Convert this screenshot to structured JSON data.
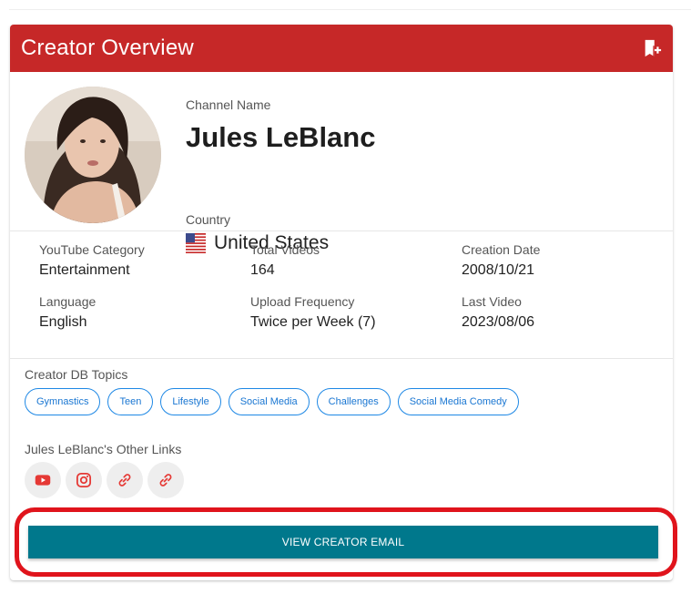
{
  "header": {
    "title": "Creator Overview",
    "bookmark_icon": "bookmark-add-icon"
  },
  "profile": {
    "channel_name_label": "Channel Name",
    "channel_name": "Jules LeBlanc",
    "country_label": "Country",
    "country": "United States",
    "flag_icon": "us-flag-icon"
  },
  "stats": [
    {
      "label": "YouTube Category",
      "value": "Entertainment"
    },
    {
      "label": "Total Videos",
      "value": "164"
    },
    {
      "label": "Creation Date",
      "value": "2008/10/21"
    },
    {
      "label": "Language",
      "value": "English"
    },
    {
      "label": "Upload Frequency",
      "value": "Twice per Week (7)"
    },
    {
      "label": "Last Video",
      "value": "2023/08/06"
    }
  ],
  "topics": {
    "label": "Creator DB Topics",
    "items": [
      "Gymnastics",
      "Teen",
      "Lifestyle",
      "Social Media",
      "Challenges",
      "Social Media Comedy"
    ]
  },
  "links": {
    "label": "Jules LeBlanc's Other Links",
    "icons": [
      "youtube-icon",
      "instagram-icon",
      "link-icon",
      "link-icon"
    ]
  },
  "cta": {
    "label": "VIEW CREATOR EMAIL"
  },
  "colors": {
    "header": "#c62828",
    "chip_border": "#1e88e5",
    "cta": "#00788c",
    "link_icon": "#e53935",
    "highlight": "#e0141c"
  }
}
